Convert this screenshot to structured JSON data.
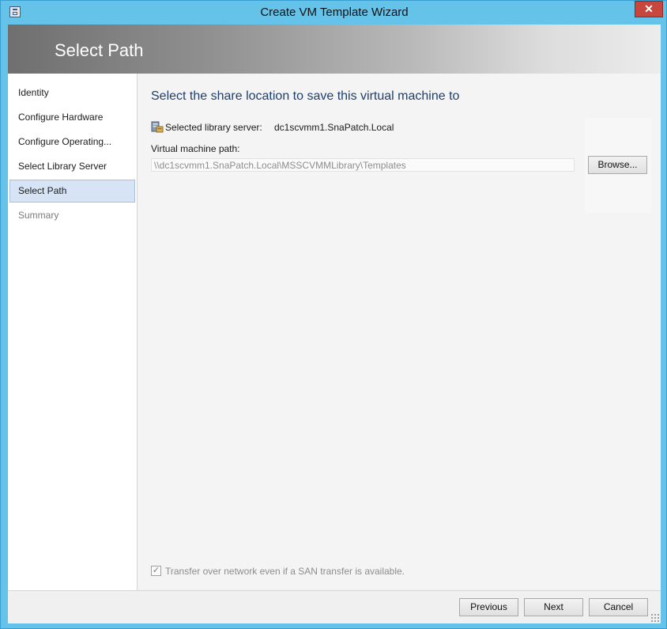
{
  "window": {
    "title": "Create VM Template Wizard",
    "close_glyph": "✕",
    "accent_color": "#65c3ea"
  },
  "header": {
    "title": "Select Path"
  },
  "sidebar": {
    "items": [
      {
        "label": "Identity",
        "state": "normal"
      },
      {
        "label": "Configure Hardware",
        "state": "normal"
      },
      {
        "label": "Configure Operating...",
        "state": "normal"
      },
      {
        "label": "Select Library Server",
        "state": "normal"
      },
      {
        "label": "Select Path",
        "state": "active"
      },
      {
        "label": "Summary",
        "state": "disabled"
      }
    ]
  },
  "content": {
    "heading": "Select the share location to save this virtual machine to",
    "server_label": "Selected library server:",
    "server_value": "dc1scvmm1.SnaPatch.Local",
    "path_label": "Virtual machine path:",
    "path_value": "\\\\dc1scvmm1.SnaPatch.Local\\MSSCVMMLibrary\\Templates",
    "browse_label": "Browse...",
    "transfer_checkbox": {
      "label": "Transfer over network even if a SAN transfer is available.",
      "checked": true,
      "enabled": false
    }
  },
  "footer": {
    "previous_label": "Previous",
    "next_label": "Next",
    "cancel_label": "Cancel"
  },
  "icons": {
    "system_menu": "window-menu-icon",
    "library_server": "library-server-icon",
    "check": "checkmark-icon",
    "resize": "resize-grip-icon"
  }
}
